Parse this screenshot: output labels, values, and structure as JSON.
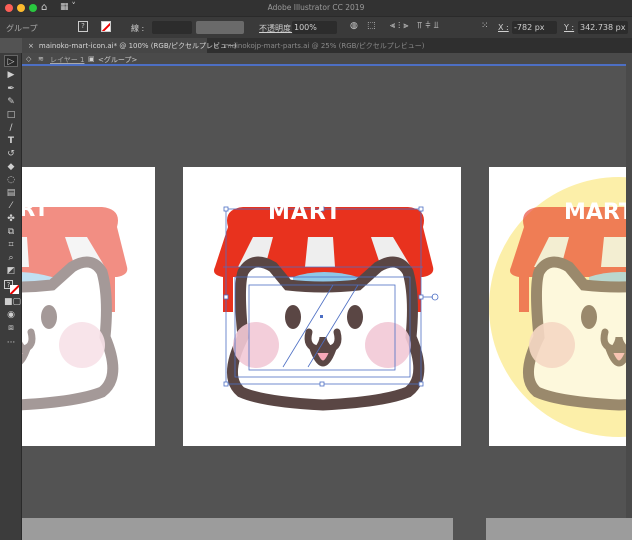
{
  "app_title": "Adobe Illustrator CC 2019",
  "control_bar": {
    "selection_label": "グループ",
    "stroke_label": "線 :",
    "opacity_label": "不透明度 :",
    "opacity_value": "100%",
    "x_label": "X :",
    "x_value": "-782 px",
    "y_label": "Y :",
    "y_value": "342.738 px"
  },
  "tabs": [
    {
      "label": "mainoko-mart-icon.ai* @ 100% (RGB/ピクセルプレビュー)",
      "active": true
    },
    {
      "label": "mainokojp-mart-parts.ai @ 25% (RGB/ピクセルプレビュー)",
      "active": false
    }
  ],
  "breadcrumb": {
    "layer": "レイヤー 1",
    "group": "<グループ>"
  },
  "artwork": {
    "sign_text": "MART"
  },
  "colors": {
    "awning_red": "#e8321e",
    "outline": "#5a4644",
    "cheek": "#f2c9d6",
    "selection": "#4d6fc4",
    "yellow_bg": "#fcefa9"
  }
}
